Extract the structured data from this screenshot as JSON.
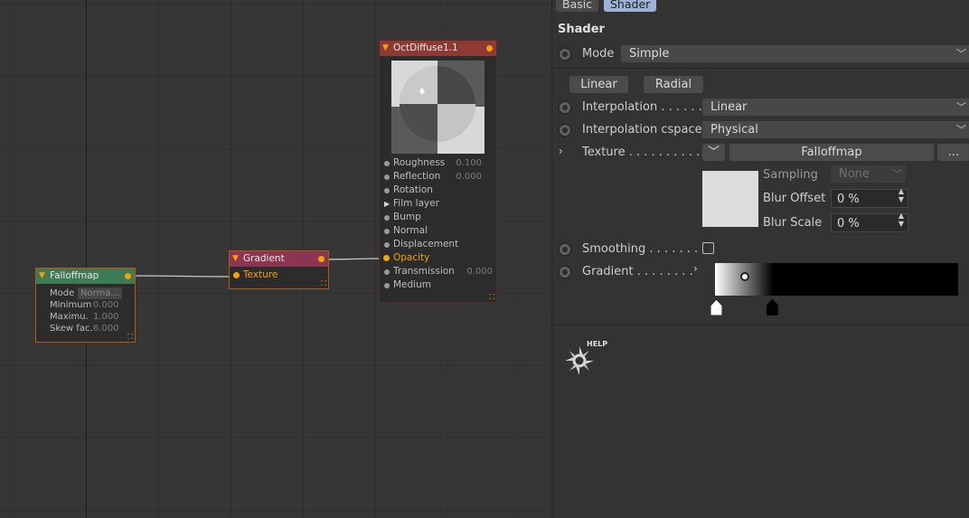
{
  "canvas": {
    "falloff": {
      "title": "Falloffmap",
      "rows": [
        {
          "label": "Mode",
          "value": "Norma..."
        },
        {
          "label": "Minimum",
          "value": "0.000"
        },
        {
          "label": "Maximu.",
          "value": "1.000"
        },
        {
          "label": "Skew fac.",
          "value": "6.000"
        }
      ]
    },
    "gradient": {
      "title": "Gradient",
      "input": "Texture"
    },
    "diffuse": {
      "title": "OctDiffuse1.1",
      "rows": [
        {
          "label": "Roughness",
          "value": "0.100"
        },
        {
          "label": "Reflection",
          "value": "0.000"
        },
        {
          "label": "Rotation",
          "value": ""
        },
        {
          "label": "Film layer",
          "value": ""
        },
        {
          "label": "Bump",
          "value": ""
        },
        {
          "label": "Normal",
          "value": ""
        },
        {
          "label": "Displacement",
          "value": ""
        },
        {
          "label": "Opacity",
          "value": ""
        },
        {
          "label": "Transmission",
          "value": "0.000"
        },
        {
          "label": "Medium",
          "value": ""
        }
      ]
    }
  },
  "panel": {
    "tabs": [
      "Basic",
      "Shader"
    ],
    "active_tab": "Shader",
    "section_title": "Shader",
    "mode": {
      "label": "Mode",
      "value": "Simple"
    },
    "buttons": {
      "linear": "Linear",
      "radial": "Radial"
    },
    "interpolation": {
      "label": "Interpolation . . . . . .",
      "value": "Linear"
    },
    "cspace": {
      "label": "Interpolation cspace",
      "value": "Physical"
    },
    "texture": {
      "label": "Texture . . . . . . . . . . .",
      "shader": "Falloffmap",
      "more": "..."
    },
    "sampling": {
      "label": "Sampling",
      "value": "None"
    },
    "blur_offset": {
      "label": "Blur Offset",
      "value": "0 %"
    },
    "blur_scale": {
      "label": "Blur Scale",
      "value": "0 %"
    },
    "smoothing": {
      "label": "Smoothing . . . . . . .",
      "checked": false
    },
    "gradient": {
      "label": "Gradient . . . . . . . ."
    },
    "help": "HELP"
  },
  "colors": {
    "accent": "#f3a20a",
    "falloff_header": "#3f7a56",
    "gradient_header": "#8c3552",
    "diffuse_header": "#8e3a34",
    "active_tab": "#9cb3d6"
  }
}
